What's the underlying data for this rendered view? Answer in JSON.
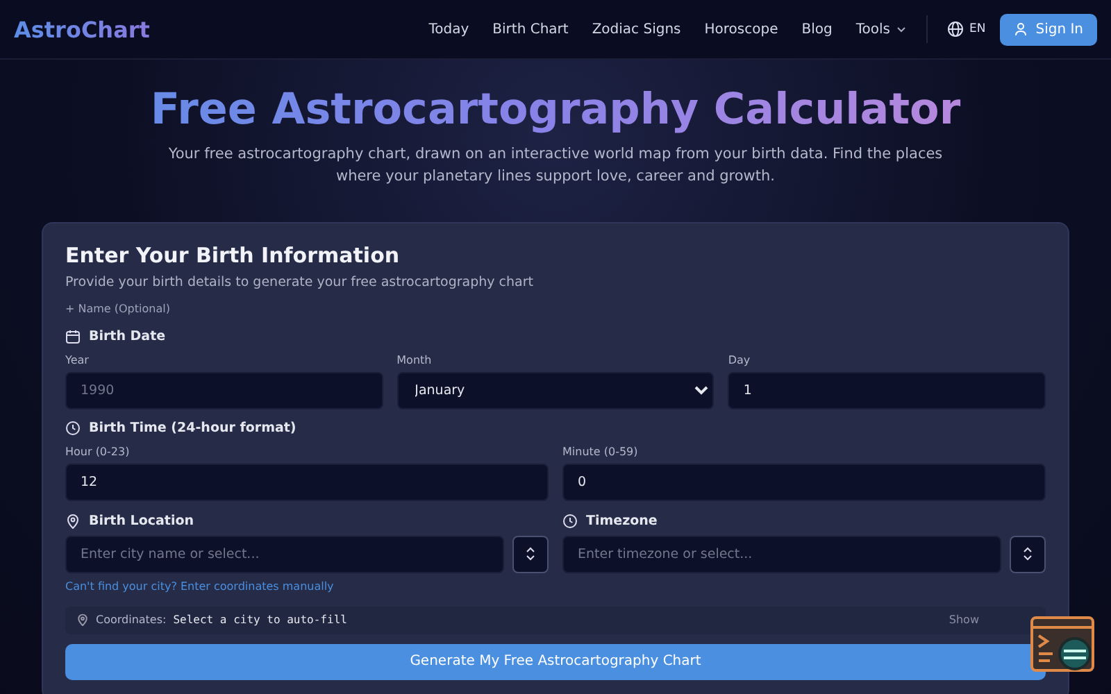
{
  "header": {
    "logo": "AstroChart",
    "nav": [
      {
        "label": "Today",
        "kind": "link"
      },
      {
        "label": "Birth Chart",
        "kind": "link"
      },
      {
        "label": "Zodiac Signs",
        "kind": "link"
      },
      {
        "label": "Horoscope",
        "kind": "link"
      },
      {
        "label": "Blog",
        "kind": "link"
      },
      {
        "label": "Tools",
        "kind": "dropdown"
      }
    ],
    "language": "EN",
    "sign_in": "Sign In"
  },
  "hero": {
    "title": "Free Astrocartography Calculator",
    "subtitle": "Your free astrocartography chart, drawn on an interactive world map from your birth data. Find the places where your planetary lines support love, career and growth."
  },
  "form": {
    "title": "Enter Your Birth Information",
    "description": "Provide your birth details to generate your free astrocartography chart",
    "name_toggle": "+ Name (Optional)",
    "birth_date": {
      "heading": "Birth Date",
      "fields": [
        {
          "label": "Year",
          "placeholder": "1990",
          "kind": "input"
        },
        {
          "label": "Month",
          "value": "January",
          "kind": "select"
        },
        {
          "label": "Day",
          "value": "1",
          "kind": "input"
        }
      ]
    },
    "birth_time": {
      "heading": "Birth Time (24-hour format)",
      "fields": [
        {
          "label": "Hour (0-23)",
          "value": "12",
          "kind": "input"
        },
        {
          "label": "Minute (0-59)",
          "value": "0",
          "kind": "input"
        }
      ]
    },
    "location": {
      "heading": "Birth Location",
      "placeholder": "Enter city name or select...",
      "link": "Can't find your city? Enter coordinates manually"
    },
    "timezone": {
      "heading": "Timezone",
      "placeholder": "Enter timezone or select..."
    },
    "coordinates": {
      "label": "Coordinates:",
      "value": "Select a city to auto-fill",
      "toggle": "Show"
    },
    "submit": "Generate My Free Astrocartography Chart"
  }
}
